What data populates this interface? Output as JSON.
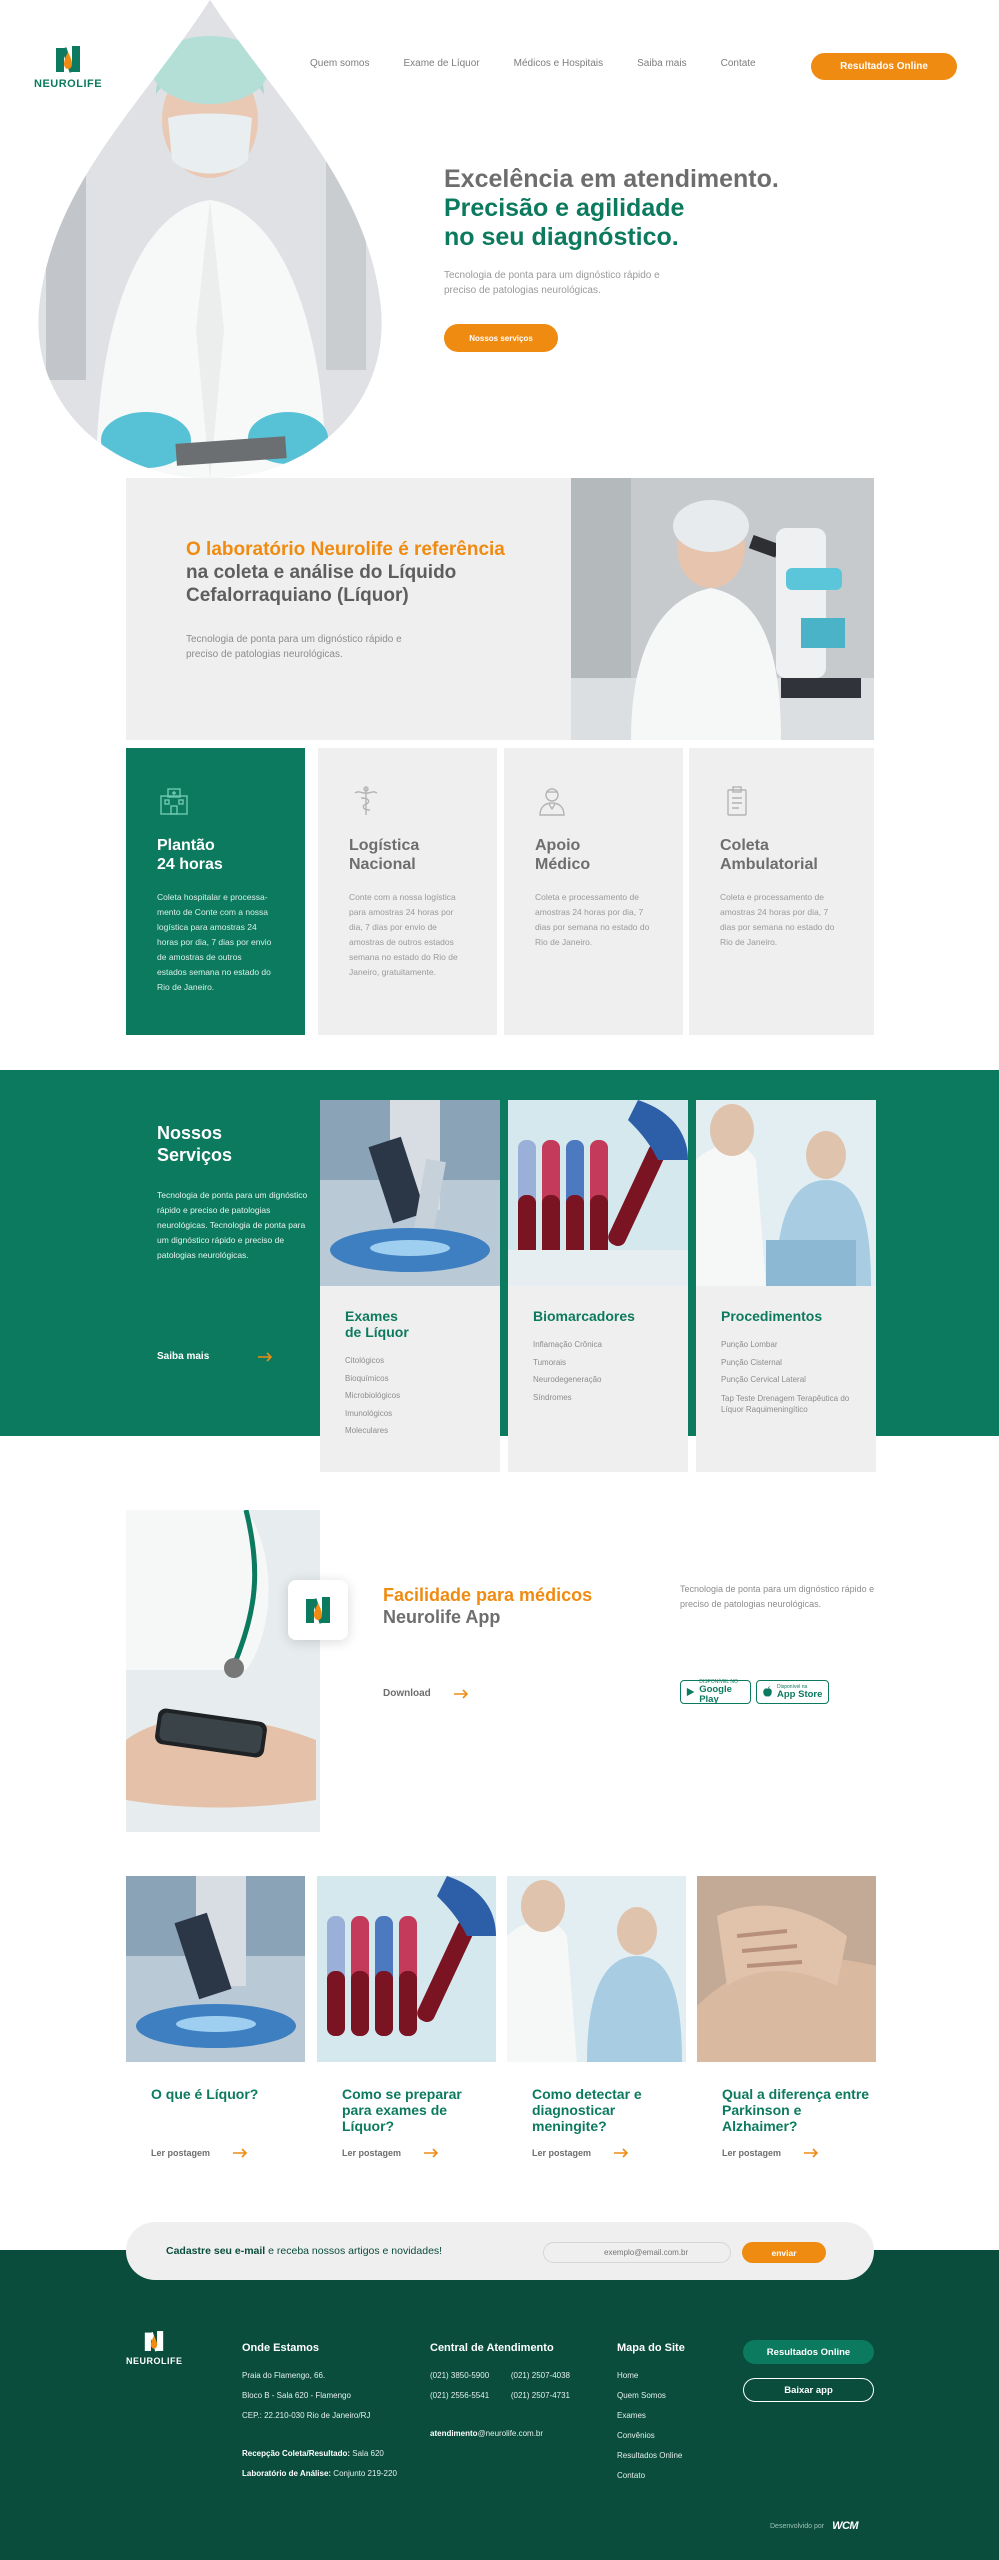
{
  "brand": {
    "name": "NEUROLIFE",
    "green": "#0c7a5e",
    "dark_green": "#0a4d3c",
    "orange": "#f08b12"
  },
  "nav": {
    "items": [
      "Quem somos",
      "Exame de Líquor",
      "Médicos e Hospitais",
      "Saiba mais",
      "Contate"
    ],
    "cta": "Resultados Online"
  },
  "hero": {
    "title_line1": "Excelência em atendimento.",
    "title_line2": "Precisão e agilidade",
    "title_line3": "no seu diagnóstico.",
    "subtitle": "Tecnologia de ponta para um dignóstico rápido e preciso de patologias neurológicas.",
    "button": "Nossos serviços"
  },
  "reference": {
    "title_highlight": "O laboratório Neurolife é referência",
    "title_rest": "na coleta e análise do Líquido Cefalorraquiano (Líquor)",
    "subtitle": "Tecnologia de ponta para um dignóstico rápido e preciso de patologias neurológicas."
  },
  "features": [
    {
      "icon": "hospital-icon",
      "title_1": "Plantão",
      "title_2": "24 horas",
      "text": "Coleta hospitalar e processa-mento de Conte com a nossa logística para amostras 24 horas por dia, 7 dias por envio de amostras de outros estados semana no estado do Rio de Janeiro."
    },
    {
      "icon": "caduceus-icon",
      "title_1": "Logística",
      "title_2": "Nacional",
      "text": "Conte com a nossa logística para amostras 24 horas por dia, 7 dias por envio de amostras de outros estados semana no estado do Rio de Janeiro, gratuitamente."
    },
    {
      "icon": "doctor-icon",
      "title_1": "Apoio",
      "title_2": "Médico",
      "text": "Coleta e processamento de amostras 24 horas por dia, 7 dias por semana no estado do Rio de Janeiro."
    },
    {
      "icon": "clipboard-icon",
      "title_1": "Coleta",
      "title_2": "Ambulatorial",
      "text": "Coleta e processamento de amostras 24 horas por dia, 7 dias por semana no estado do Rio de Janeiro."
    }
  ],
  "services": {
    "title_1": "Nossos",
    "title_2": "Serviços",
    "subtitle": "Tecnologia de ponta para um dignóstico rápido e preciso de patologias neurológicas. Tecnologia de ponta para um dignóstico rápido e preciso de patologias neurológicas.",
    "more": "Saiba mais",
    "cards": [
      {
        "title_1": "Exames",
        "title_2": "de Líquor",
        "items": [
          "Citológicos",
          "Bioquímicos",
          "Microbiológicos",
          "Imunológicos",
          "Moleculares"
        ]
      },
      {
        "title_1": "Biomarcadores",
        "title_2": "",
        "items": [
          "Inflamação Crônica",
          "Tumorais",
          "Neurodegeneração",
          "Síndromes"
        ]
      },
      {
        "title_1": "Procedimentos",
        "title_2": "",
        "items": [
          "Punção Lombar",
          "Punção Cisternal",
          "Punção Cervical Lateral",
          "Tap Teste Drenagem Terapêutica do Líquor Raquimeningítico"
        ]
      }
    ]
  },
  "app": {
    "title_1": "Facilidade para médicos",
    "title_2": "Neurolife App",
    "download": "Download",
    "subtitle": "Tecnologia de ponta para um dignóstico rápido e preciso de patologias neurológicas.",
    "google_small": "DISPONÍVEL NO",
    "google": "Google Play",
    "apple_small": "Disponível na",
    "apple": "App Store"
  },
  "blog": {
    "read": "Ler postagem",
    "posts": [
      {
        "title": "O que é Líquor?"
      },
      {
        "title": "Como se preparar para exames de Líquor?"
      },
      {
        "title": "Como detectar e diagnosticar meningite?"
      },
      {
        "title": "Qual a diferença entre Parkinson e Alzhaimer?"
      }
    ]
  },
  "newsletter": {
    "text_bold": "Cadastre seu e-mail",
    "text_rest": "e receba nossos artigos e novidades!",
    "placeholder": "exemplo@email.com.br",
    "button": "enviar"
  },
  "footer": {
    "where_title": "Onde Estamos",
    "where_lines": [
      "Praia do Flamengo, 66.",
      "Bloco B - Sala 620 - Flamengo",
      "CEP.: 22.210-030 Rio de Janeiro/RJ"
    ],
    "reception_label": "Recepção Coleta/Resultado:",
    "reception_value": "Sala 620",
    "lab_label": "Laboratório de Análise:",
    "lab_value": "Conjunto 219-220",
    "contact_title": "Central de Atendimento",
    "phones": [
      "(021) 3850-5900",
      "(021) 2507-4038",
      "(021) 2556-5541",
      "(021) 2507-4731"
    ],
    "email_bold": "atendimento",
    "email_rest": "@neurolife.com.br",
    "map_title": "Mapa do Site",
    "map_items": [
      "Home",
      "Quem Somos",
      "Exames",
      "Convênios",
      "Resultados Online",
      "Contato"
    ],
    "btn_results": "Resultados Online",
    "btn_app": "Baixar app",
    "developed": "Desenvolvido por",
    "dev_logo": "WCM"
  }
}
